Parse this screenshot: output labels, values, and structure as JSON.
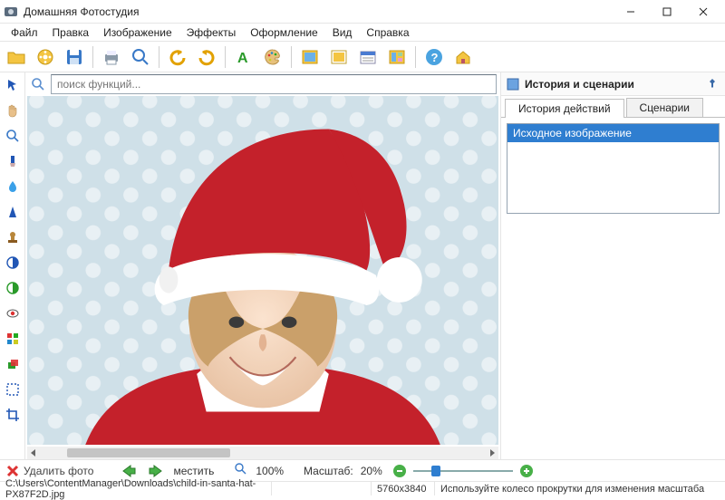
{
  "window": {
    "title": "Домашняя Фотостудия"
  },
  "menu": {
    "items": [
      "Файл",
      "Правка",
      "Изображение",
      "Эффекты",
      "Оформление",
      "Вид",
      "Справка"
    ]
  },
  "search": {
    "placeholder": "поиск функций..."
  },
  "right_panel": {
    "title": "История и сценарии",
    "tabs": [
      "История действий",
      "Сценарии"
    ],
    "active_tab": 0,
    "history_item": "Исходное изображение"
  },
  "bottom": {
    "delete": "Удалить фото",
    "fit": "местить",
    "zoom_actual": "100%",
    "scale_label": "Масштаб:",
    "scale_value": "20%"
  },
  "status": {
    "path": "C:\\Users\\ContentManager\\Downloads\\child-in-santa-hat-PX87F2D.jpg",
    "dims": "5760x3840",
    "hint": "Используйте колесо прокрутки для изменения масштаба"
  }
}
